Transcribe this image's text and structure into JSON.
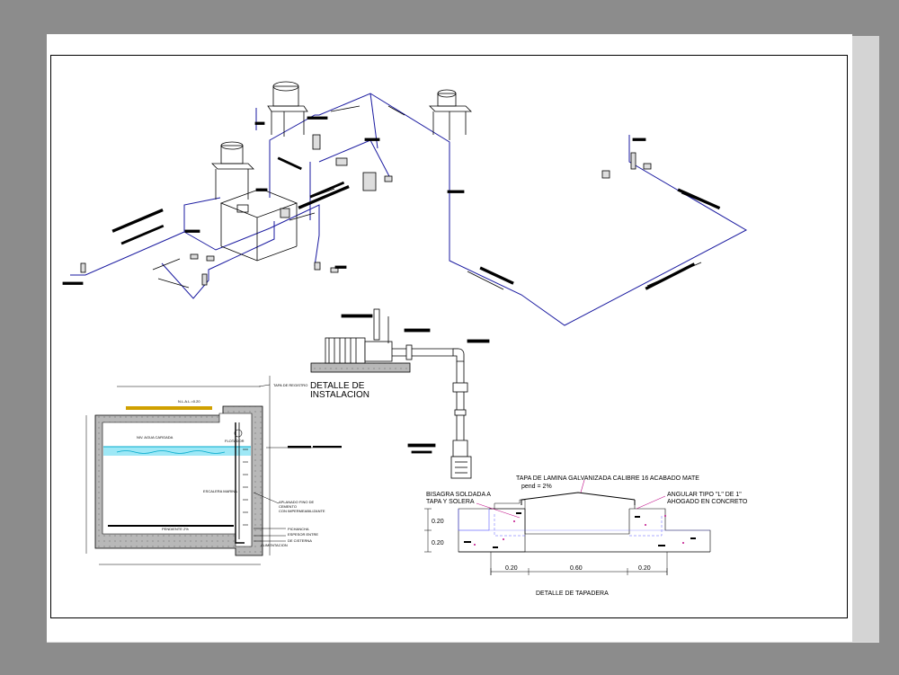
{
  "colors": {
    "background": "#8c8c8c",
    "sheet": "#ffffff",
    "pipe": "#1a1aa0",
    "water": "#33ccee",
    "concrete": "#a6a6a6",
    "dimension": "#d0a000",
    "linework": "#000000",
    "annotation": "#c0108a"
  },
  "installation_detail": {
    "title_line1": "DETALLE  DE",
    "title_line2": "INSTALACION"
  },
  "cover_detail": {
    "top_note": "TAPA DE LAMINA GALVANIZADA CALIBRE 16 ACABADO MATE",
    "slope_note": "pend = 2%",
    "left_note_line1": "BISAGRA SOLDADA A",
    "left_note_line2": "TAPA Y SOLERA",
    "right_note_line1": "ANGULAR TIPO \"L\" DE 1\"",
    "right_note_line2": "AHOGADO EN CONCRETO",
    "height_dim_top": "0.20",
    "height_dim_bottom": "0.20",
    "width_dims": [
      "0.20",
      "0.60",
      "0.20"
    ],
    "title": "DETALLE DE TAPADERA"
  },
  "cistern_section": {
    "water_level_label": "NIV. AGUA CARGADA",
    "floater_label": "FLOTADOR",
    "ladder_label": "ESCALERA MARINA",
    "right_note_lines": [
      "APLANADO FINO DE",
      "CEMENTO",
      "CON IMPERMEABILIZANTE"
    ],
    "bottom_labels": [
      "PICHANCHA",
      "ESPESOR ENTRE",
      "DE CISTERNA"
    ],
    "top_label": "TAPA DE REGISTRO",
    "tag_label": "PENDIENTE 2%",
    "ceiling_label": "N.L.A.L.=0.20",
    "pipe_label": "ALIMENTACION"
  },
  "icons": [
    "water-tank-icon",
    "pump-icon",
    "valve-icon",
    "flow-arrow-icon"
  ]
}
